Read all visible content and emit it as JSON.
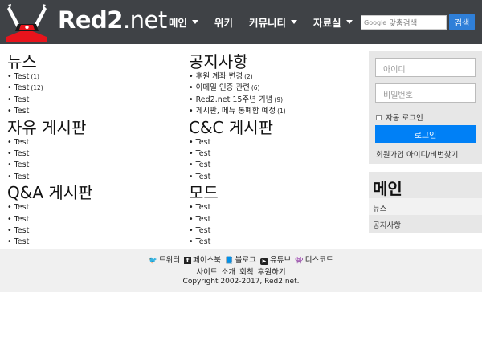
{
  "header": {
    "brand_main": "Red2",
    "brand_tld": ".net",
    "nav": [
      {
        "label": "메인",
        "dropdown": true
      },
      {
        "label": "위키",
        "dropdown": false
      },
      {
        "label": "커뮤니티",
        "dropdown": true
      },
      {
        "label": "자료실",
        "dropdown": true
      }
    ],
    "search": {
      "google_label": "Google",
      "placeholder": "맞춤검색",
      "button": "검색"
    },
    "colors": {
      "bar": "#3f4246",
      "search_button": "#2f7fd8",
      "logo_red": "#e8141c"
    }
  },
  "sections": {
    "news": {
      "title": "뉴스",
      "posts": [
        {
          "text": "Test",
          "count": "(1)"
        },
        {
          "text": "Test",
          "count": "(12)"
        },
        {
          "text": "Test",
          "count": ""
        },
        {
          "text": "Test",
          "count": ""
        }
      ]
    },
    "notice": {
      "title": "공지사항",
      "posts": [
        {
          "text": "후원 계좌 변경",
          "count": "(2)"
        },
        {
          "text": "이메일 인증 관련",
          "count": "(6)"
        },
        {
          "text": "Red2.net 15주년 기념",
          "count": "(9)"
        },
        {
          "text": "게시판, 메뉴 통폐합 예정",
          "count": "(1)"
        }
      ]
    },
    "free": {
      "title": "자유 게시판",
      "posts": [
        {
          "text": "Test",
          "count": ""
        },
        {
          "text": "Test",
          "count": ""
        },
        {
          "text": "Test",
          "count": ""
        },
        {
          "text": "Test",
          "count": ""
        }
      ]
    },
    "cnc": {
      "title": "C&C 게시판",
      "posts": [
        {
          "text": "Test",
          "count": ""
        },
        {
          "text": "Test",
          "count": ""
        },
        {
          "text": "Test",
          "count": ""
        },
        {
          "text": "Test",
          "count": ""
        }
      ]
    },
    "qna": {
      "title": "Q&A 게시판",
      "posts": [
        {
          "text": "Test",
          "count": ""
        },
        {
          "text": "Test",
          "count": ""
        },
        {
          "text": "Test",
          "count": ""
        },
        {
          "text": "Test",
          "count": ""
        }
      ]
    },
    "mod": {
      "title": "모드",
      "posts": [
        {
          "text": "Test",
          "count": ""
        },
        {
          "text": "Test",
          "count": ""
        },
        {
          "text": "Test",
          "count": ""
        },
        {
          "text": "Test",
          "count": ""
        }
      ]
    }
  },
  "login": {
    "id_placeholder": "아이디",
    "pw_placeholder": "비밀번호",
    "auto_login": "자동 로그인",
    "button": "로그인",
    "links": "회원가입 아이디/비번찾기",
    "button_color": "#0080f6"
  },
  "sidemenu": {
    "title": "메인",
    "items": [
      "뉴스",
      "공지사항"
    ]
  },
  "footer": {
    "social": [
      {
        "icon": "twitter-icon",
        "label": "트위터"
      },
      {
        "icon": "facebook-icon",
        "label": "페이스북"
      },
      {
        "icon": "blog-icon",
        "label": "블로그"
      },
      {
        "icon": "youtube-icon",
        "label": "유튜브"
      },
      {
        "icon": "discord-icon",
        "label": "디스코드"
      }
    ],
    "links": "사이트 소개 회칙 후원하기",
    "copyright": "Copyright 2002-2017, Red2.net."
  }
}
